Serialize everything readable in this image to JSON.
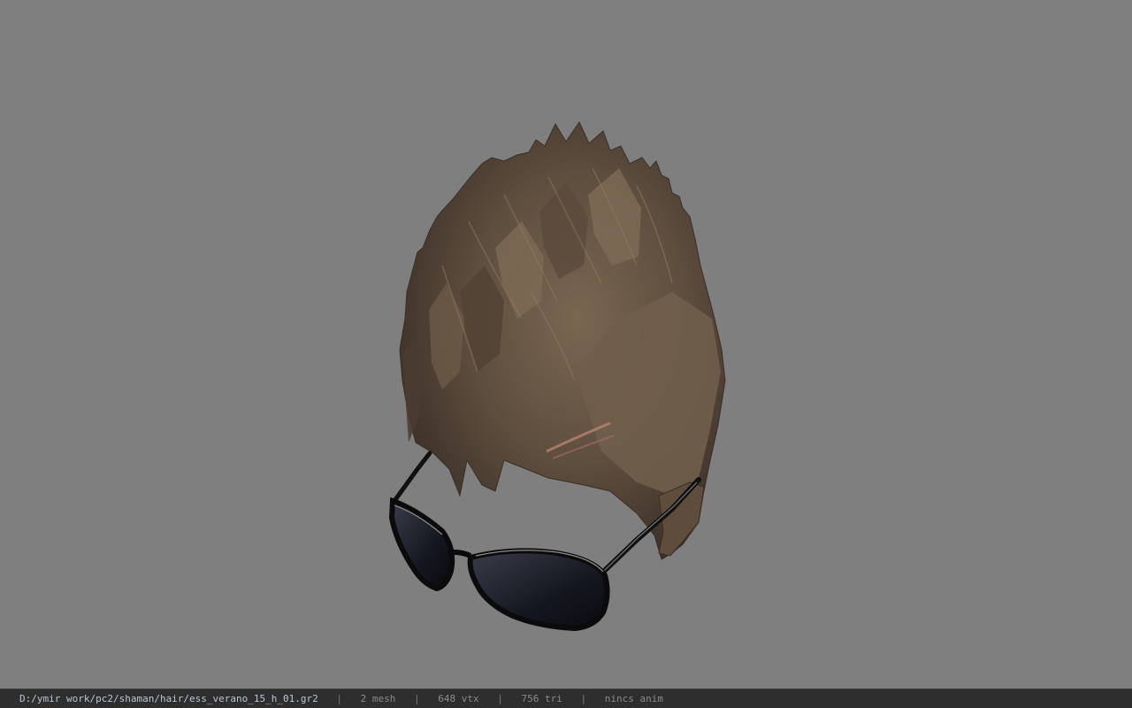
{
  "viewer": {
    "background_color": "#7f7f7f",
    "model_icons": [
      "hair-mesh-icon",
      "sunglasses-mesh-icon"
    ]
  },
  "statusbar": {
    "file_path": "D:/ymir work/pc2/shaman/hair/ess_verano_15_h_01.gr2",
    "separator": "|",
    "mesh_count": "2 mesh",
    "vertex_count": "648 vtx",
    "triangle_count": "756 tri",
    "anim_status": "nincs anim",
    "text_color": "#8a8a8a",
    "path_color": "#b8c6d6",
    "bar_color": "#2e2e2e"
  }
}
